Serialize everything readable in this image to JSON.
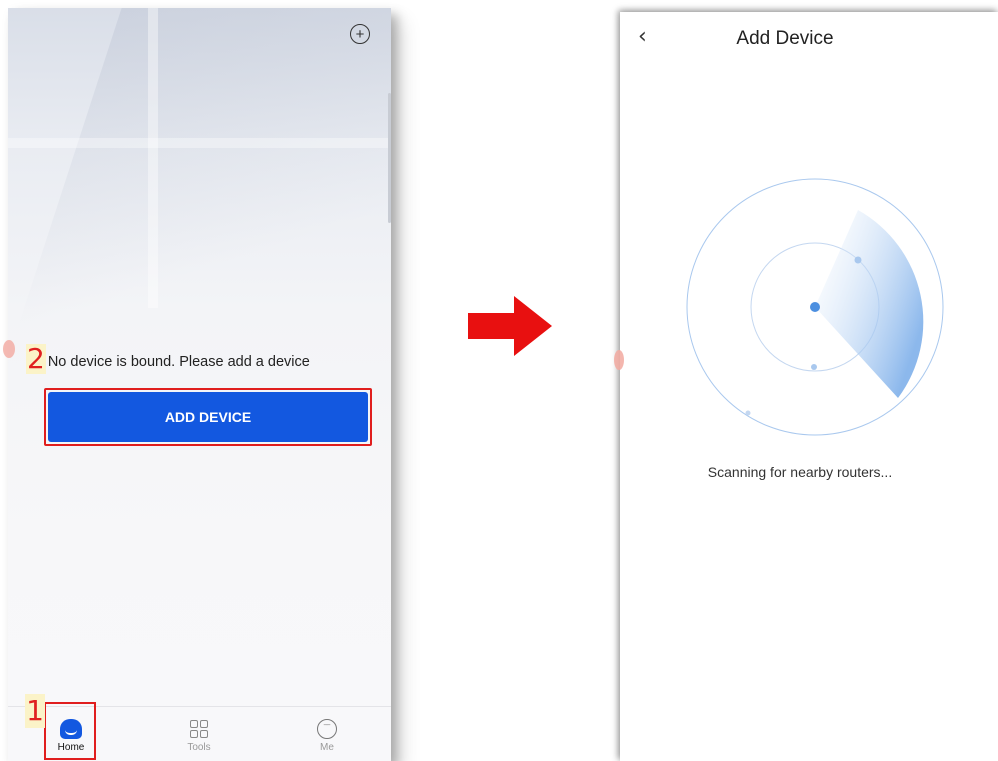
{
  "left_screen": {
    "message_annotation": "2",
    "message": "No device is bound. Please add a device",
    "add_device_label": "ADD DEVICE",
    "tabs": [
      {
        "label": "Home",
        "icon": "home-icon",
        "active": true
      },
      {
        "label": "Tools",
        "icon": "grid-icon",
        "active": false
      },
      {
        "label": "Me",
        "icon": "face-icon",
        "active": false
      }
    ],
    "home_annotation": "1"
  },
  "right_screen": {
    "title": "Add Device",
    "scanning_text": "Scanning for nearby routers..."
  },
  "colors": {
    "primary_button": "#1358e0",
    "annotation_red": "#e01e1e",
    "arrow_red": "#e81010",
    "radar_blue": "#8fb8ec"
  }
}
